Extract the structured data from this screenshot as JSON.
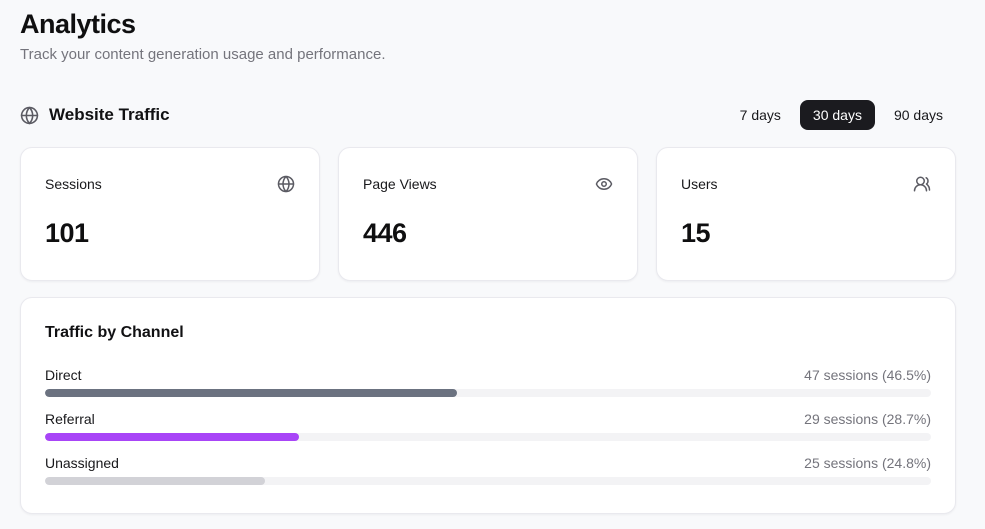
{
  "page": {
    "title": "Analytics",
    "subtitle": "Track your content generation usage and performance."
  },
  "section": {
    "title": "Website Traffic",
    "icon": "globe-icon",
    "ranges": [
      {
        "label": "7 days",
        "active": false
      },
      {
        "label": "30 days",
        "active": true
      },
      {
        "label": "90 days",
        "active": false
      }
    ],
    "active_range": "30 days"
  },
  "stats": [
    {
      "label": "Sessions",
      "value": "101",
      "icon": "globe-icon"
    },
    {
      "label": "Page Views",
      "value": "446",
      "icon": "eye-icon"
    },
    {
      "label": "Users",
      "value": "15",
      "icon": "users-icon"
    }
  ],
  "chart_data": {
    "type": "bar",
    "title": "Traffic by Channel",
    "categories": [
      "Direct",
      "Referral",
      "Unassigned"
    ],
    "values": [
      47,
      29,
      25
    ],
    "unit": "sessions",
    "percentages": [
      46.5,
      28.7,
      24.8
    ],
    "value_labels": [
      "47 sessions (46.5%)",
      "29 sessions (28.7%)",
      "25 sessions (24.8%)"
    ],
    "bar_colors": [
      "#6b7280",
      "#a845f7",
      "#d2d2d7"
    ],
    "track_color": "#f3f3f5",
    "orientation": "horizontal",
    "xlim": [
      0,
      100
    ]
  },
  "colors": {
    "background": "#f8f9fb",
    "card_background": "#ffffff",
    "card_border": "#e9e9ee",
    "active_button_bg": "#1b1b1f",
    "active_button_text": "#ffffff",
    "muted_text": "#74747c",
    "accent_purple": "#a845f7"
  }
}
